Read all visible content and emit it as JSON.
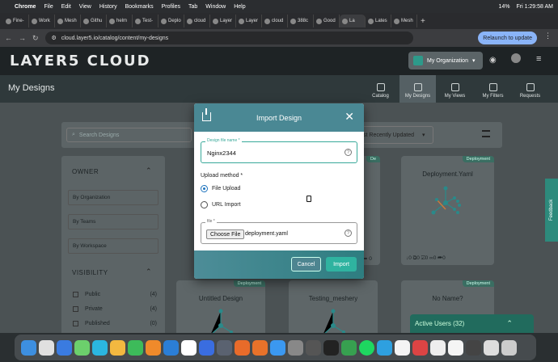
{
  "menubar": {
    "items": [
      "Chrome",
      "File",
      "Edit",
      "View",
      "History",
      "Bookmarks",
      "Profiles",
      "Tab",
      "Window",
      "Help"
    ],
    "battery": "14%",
    "datetime": "Fri 1:29:58 AM"
  },
  "tabs": [
    "Fine-",
    "Work",
    "Mesh",
    "Githu",
    "helm",
    "Test-",
    "Deplo",
    "cloud",
    "Layer",
    "Layer",
    "cloud",
    "388c",
    "Good",
    "La",
    "Lates",
    "Mesh"
  ],
  "address": {
    "url": "cloud.layer5.io/catalog/content/my-designs",
    "relaunch_label": "Relaunch to update"
  },
  "header": {
    "logo": "LAYER5 CLOUD",
    "org_label": "My Organization"
  },
  "subheader": {
    "title": "My Designs",
    "nav": [
      "Catalog",
      "My Designs",
      "My Views",
      "My Filters",
      "Requests"
    ]
  },
  "toolbar": {
    "search_placeholder": "Search Designs",
    "sort_label": "st Recently Updated"
  },
  "filters": {
    "owner_title": "OWNER",
    "owner_buttons": [
      "By Organization",
      "By Teams",
      "By Workspace"
    ],
    "visibility_title": "VISIBILITY",
    "visibility": [
      {
        "label": "Public",
        "count": "(4)"
      },
      {
        "label": "Private",
        "count": "(4)"
      },
      {
        "label": "Published",
        "count": "(0)"
      }
    ]
  },
  "cards": {
    "deployment_yaml": {
      "tag": "Deployment",
      "title": "Deployment.Yaml",
      "stats": "↓0  ⧉0  ☑0  ∞0  ➦0"
    },
    "untitled": {
      "tag": "Deployment",
      "title": "Untitled Design"
    },
    "testing_meshery": {
      "tag": "",
      "title": "Testing_meshery"
    },
    "no_name": {
      "tag": "Deployment",
      "title": "No Name?"
    },
    "partial_tag": "De",
    "partial_stats": "↓ 0  ⧉ 0",
    "partial_stats2": "➦ 0"
  },
  "modal": {
    "title": "Import Design",
    "name_label": "Design file name *",
    "name_value": "Nginx2344",
    "method_label": "Upload method *",
    "options": [
      "File Upload",
      "URL Import"
    ],
    "selected_option": "File Upload",
    "file_label": "file *",
    "choose_label": "Choose File",
    "file_name": "deployment.yaml",
    "cancel_label": "Cancel",
    "import_label": "Import"
  },
  "feedback_label": "Feedback",
  "active_users_label": "Active Users (32)",
  "colors": {
    "accent": "#2fb3a0",
    "modal_header": "#4a8894",
    "header_bg": "#1e2325"
  }
}
